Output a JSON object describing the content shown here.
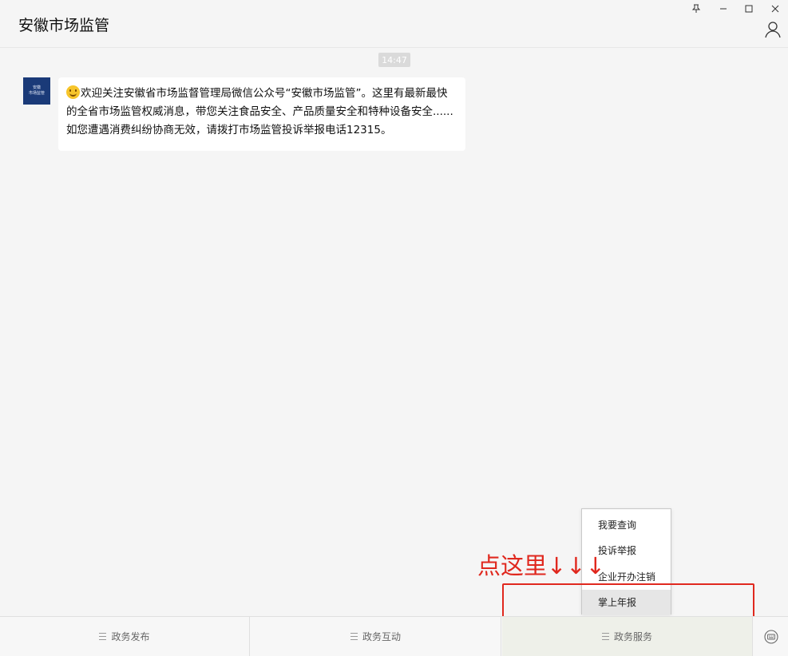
{
  "window": {
    "title": "安徽市场监管",
    "pin_icon": "pin-icon",
    "minimize_icon": "minimize-icon",
    "maximize_icon": "maximize-icon",
    "close_icon": "close-icon",
    "profile_icon": "user-profile-icon"
  },
  "chat": {
    "timestamp": "14:47",
    "avatar_lines": [
      "安徽",
      "市场监管"
    ],
    "message": "欢迎关注安徽省市场监督管理局微信公众号“安徽市场监管”。这里有最新最快的全省市场监管权威消息，带您关注食品安全、产品质量安全和特种设备安全......如您遭遇消费纠纷协商无效，请拨打市场监管投诉举报电话12315。",
    "emoji": "smile-emoji-icon"
  },
  "popup_menu": {
    "items": [
      {
        "label": "我要查询"
      },
      {
        "label": "投诉举报"
      },
      {
        "label": "企业开办注销"
      },
      {
        "label": "掌上年报",
        "selected": true
      }
    ]
  },
  "annotation": {
    "text": "点这里↓↓↓",
    "color": "#e0281e"
  },
  "bottom_menu": {
    "items": [
      {
        "label": "政务发布"
      },
      {
        "label": "政务互动"
      },
      {
        "label": "政务服务",
        "active": true
      }
    ],
    "keyboard_icon": "keyboard-toggle-icon"
  },
  "colors": {
    "background": "#f5f5f5",
    "avatar": "#1a3a78",
    "active_menu": "#eef0e9"
  }
}
